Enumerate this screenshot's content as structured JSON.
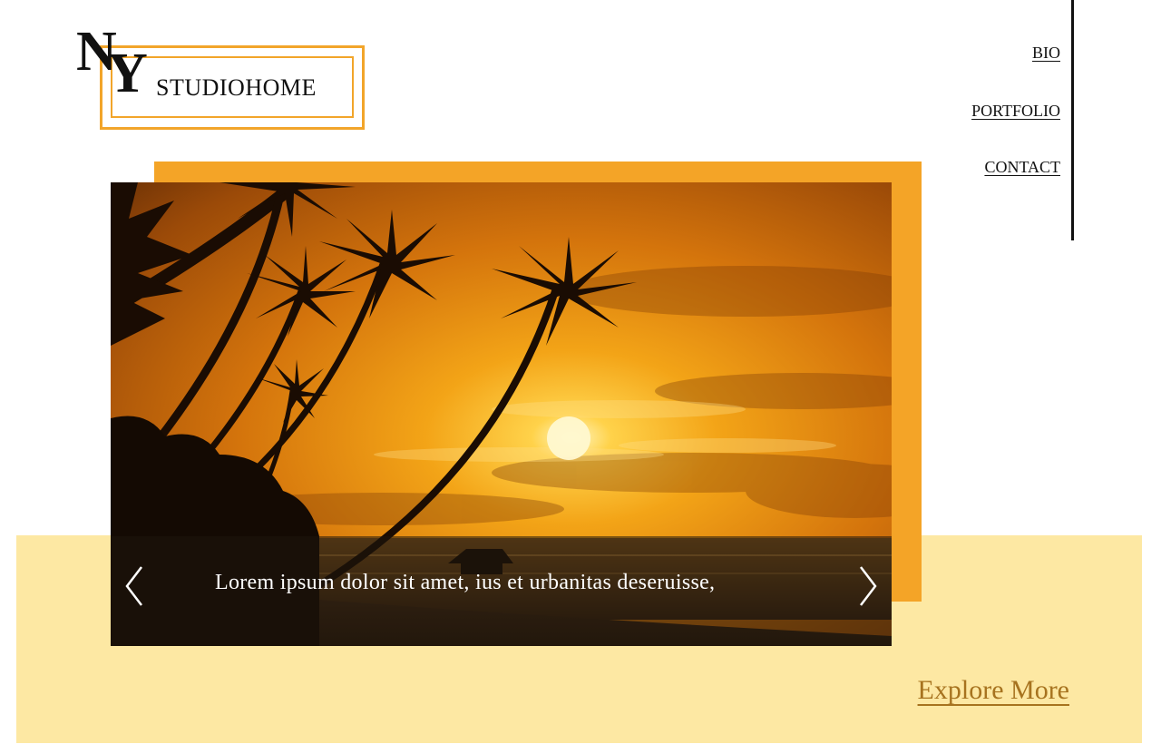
{
  "brand": {
    "mark_letter_1": "N",
    "mark_letter_2": "Y",
    "name": "STUDIOHOME",
    "accent_color": "#f4a427"
  },
  "nav": {
    "items": [
      {
        "label": "BIO"
      },
      {
        "label": "PORTFOLIO"
      },
      {
        "label": "CONTACT"
      }
    ]
  },
  "slider": {
    "caption": "Lorem ipsum dolor sit amet, ius et urbanitas deseruisse,",
    "prev_icon": "chevron-left-icon",
    "next_icon": "chevron-right-icon",
    "image_subject": "tropical beach sunset with palm trees"
  },
  "cta": {
    "label": "Explore More",
    "color": "#a7731f"
  },
  "colors": {
    "band": "#fde8a3",
    "orange": "#f4a427"
  }
}
